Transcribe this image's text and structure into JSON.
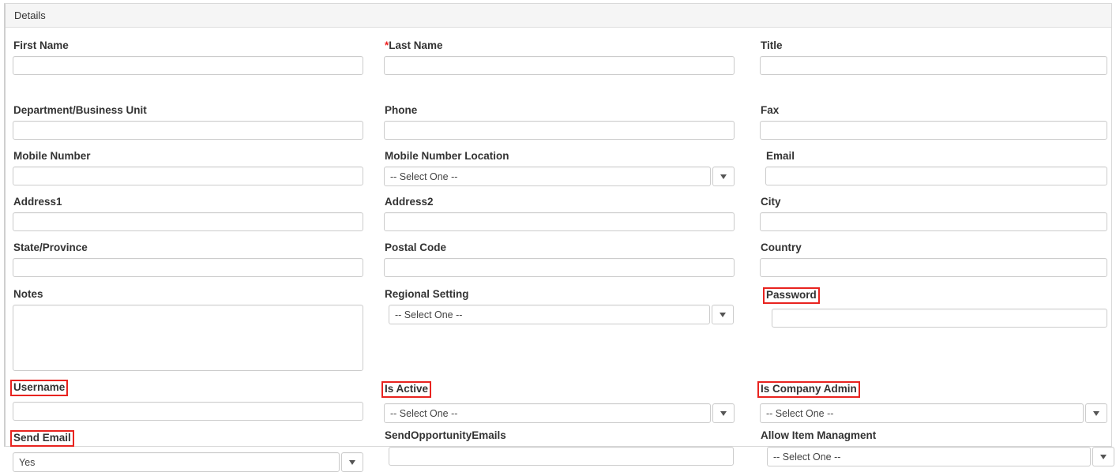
{
  "panel": {
    "title": "Details"
  },
  "colors": {
    "highlight_box": "#e8231f",
    "required_star": "#ee2222",
    "header_bg": "#f5f5f5",
    "border": "#cccccc",
    "label_text": "#333333"
  },
  "select_placeholder": "-- Select One --",
  "fields": {
    "first_name": {
      "label": "First Name",
      "value": ""
    },
    "last_name": {
      "label": "Last Name",
      "value": "",
      "required_marker": "*"
    },
    "title": {
      "label": "Title",
      "value": ""
    },
    "department": {
      "label": "Department/Business Unit",
      "value": ""
    },
    "phone": {
      "label": "Phone",
      "value": ""
    },
    "fax": {
      "label": "Fax",
      "value": ""
    },
    "mobile_number": {
      "label": "Mobile Number",
      "value": ""
    },
    "mobile_location": {
      "label": "Mobile Number Location",
      "value": "-- Select One --"
    },
    "email": {
      "label": "Email",
      "value": ""
    },
    "address1": {
      "label": "Address1",
      "value": ""
    },
    "address2": {
      "label": "Address2",
      "value": ""
    },
    "city": {
      "label": "City",
      "value": ""
    },
    "state_province": {
      "label": "State/Province",
      "value": ""
    },
    "postal_code": {
      "label": "Postal Code",
      "value": ""
    },
    "country": {
      "label": "Country",
      "value": ""
    },
    "notes": {
      "label": "Notes",
      "value": ""
    },
    "regional_setting": {
      "label": "Regional Setting",
      "value": "-- Select One --"
    },
    "password": {
      "label": "Password",
      "value": ""
    },
    "username": {
      "label": "Username",
      "value": ""
    },
    "is_active": {
      "label": "Is Active",
      "value": "-- Select One --"
    },
    "is_company_admin": {
      "label": "Is Company Admin",
      "value": "-- Select One --"
    },
    "send_email": {
      "label": "Send Email",
      "value": "Yes"
    },
    "send_opp_emails": {
      "label": "SendOpportunityEmails",
      "value": ""
    },
    "allow_item_mgmt": {
      "label": "Allow Item Managment",
      "value": "-- Select One --"
    }
  },
  "icons": {
    "caret_down": "chevron-down-icon"
  }
}
